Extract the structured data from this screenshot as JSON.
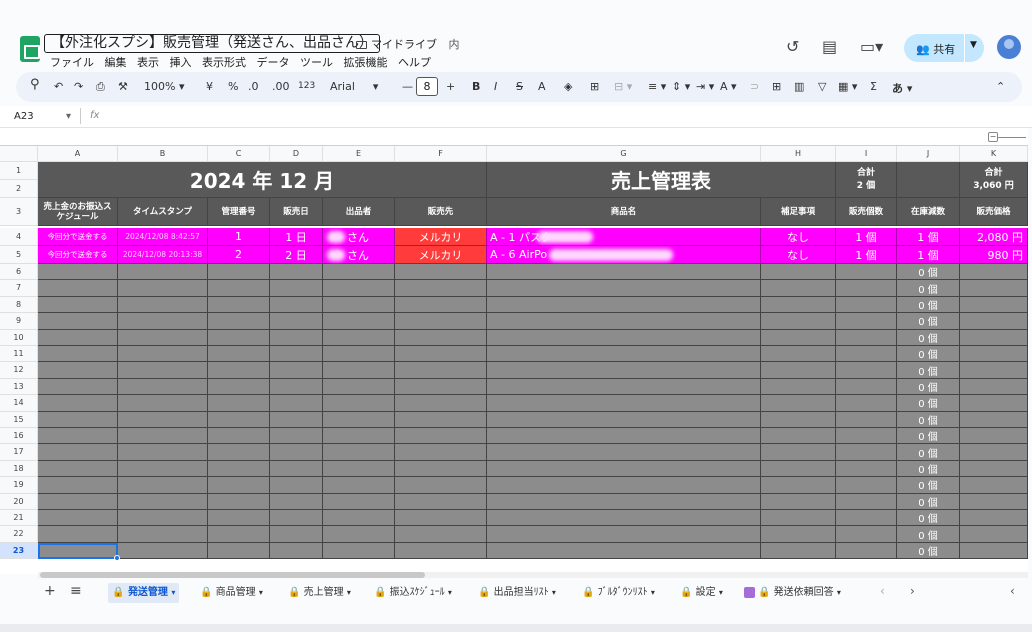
{
  "doc": {
    "title": "【外注化スプシ】販売管理（発送さん、出品さん）",
    "drive_label": "マイドライブ",
    "drive_suffix": "内",
    "menu": [
      "ファイル",
      "編集",
      "表示",
      "挿入",
      "表示形式",
      "データ",
      "ツール",
      "拡張機能",
      "ヘルプ"
    ],
    "share_label": "共有"
  },
  "toolbar": {
    "zoom": "100%",
    "currency": "¥",
    "percent": "%",
    "dec_minus": ".0",
    "dec_plus": ".00",
    "num_fmt": "123",
    "font": "Arial",
    "font_size": "8",
    "bold": "B",
    "italic": "I",
    "strike": "S",
    "text_color": "A",
    "ime": "あ"
  },
  "formula_bar": {
    "cell_ref": "A23",
    "fx": "fx"
  },
  "grid": {
    "col_headers": [
      "A",
      "B",
      "C",
      "D",
      "E",
      "F",
      "G",
      "H",
      "I",
      "J",
      "K"
    ],
    "title_left": "2024 年 12 月",
    "title_main": "売上管理表",
    "total_count_label": "合計",
    "total_count": "2 個",
    "total_price_label": "合計",
    "total_price": "3,060 円",
    "headers": [
      "売上金のお振込スケジュール",
      "タイムスタンプ",
      "管理番号",
      "販売日",
      "出品者",
      "販売先",
      "商品名",
      "補足事項",
      "販売個数",
      "在庫減数",
      "販売価格"
    ],
    "rows": [
      {
        "num": "4",
        "a": "今回分で送金する",
        "b": "2024/12/08 8:42:57",
        "c": "1",
        "d": "1 日",
        "e": "さん",
        "f": "メルカリ",
        "g": "A - 1 パスタ",
        "h": "なし",
        "i": "1 個",
        "j": "1 個",
        "k": "2,080 円"
      },
      {
        "num": "5",
        "a": "今回分で送金する",
        "b": "2024/12/08 20:13:38",
        "c": "2",
        "d": "2 日",
        "e": "さん",
        "f": "メルカリ",
        "g": "A - 6 AirPo",
        "h": "なし",
        "i": "1 個",
        "j": "1 個",
        "k": "980 円"
      }
    ],
    "empty_rows": [
      "6",
      "7",
      "8",
      "9",
      "10",
      "11",
      "12",
      "13",
      "14",
      "15",
      "16",
      "17",
      "18",
      "19",
      "20",
      "21",
      "22",
      "23"
    ],
    "empty_j": "0 個",
    "row_nums_top": [
      "1",
      "2",
      "3"
    ]
  },
  "sheets": {
    "tabs": [
      {
        "label": "発送管理",
        "active": true
      },
      {
        "label": "商品管理",
        "active": false
      },
      {
        "label": "売上管理",
        "active": false
      },
      {
        "label": "振込ｽｹｼﾞｭｰﾙ",
        "active": false
      },
      {
        "label": "出品担当ﾘｽﾄ",
        "active": false
      },
      {
        "label": "ﾌﾞﾙﾀﾞｳﾝﾘｽﾄ",
        "active": false
      },
      {
        "label": "設定",
        "active": false
      },
      {
        "label": "発送依頼回答",
        "active": false
      }
    ]
  },
  "colors": {
    "header_dark": "#595959",
    "row_gray": "#8c8c8c",
    "highlight_magenta": "#ff00ff",
    "mercari_red": "#ff3b3b",
    "accent_blue": "#1a73e8"
  }
}
